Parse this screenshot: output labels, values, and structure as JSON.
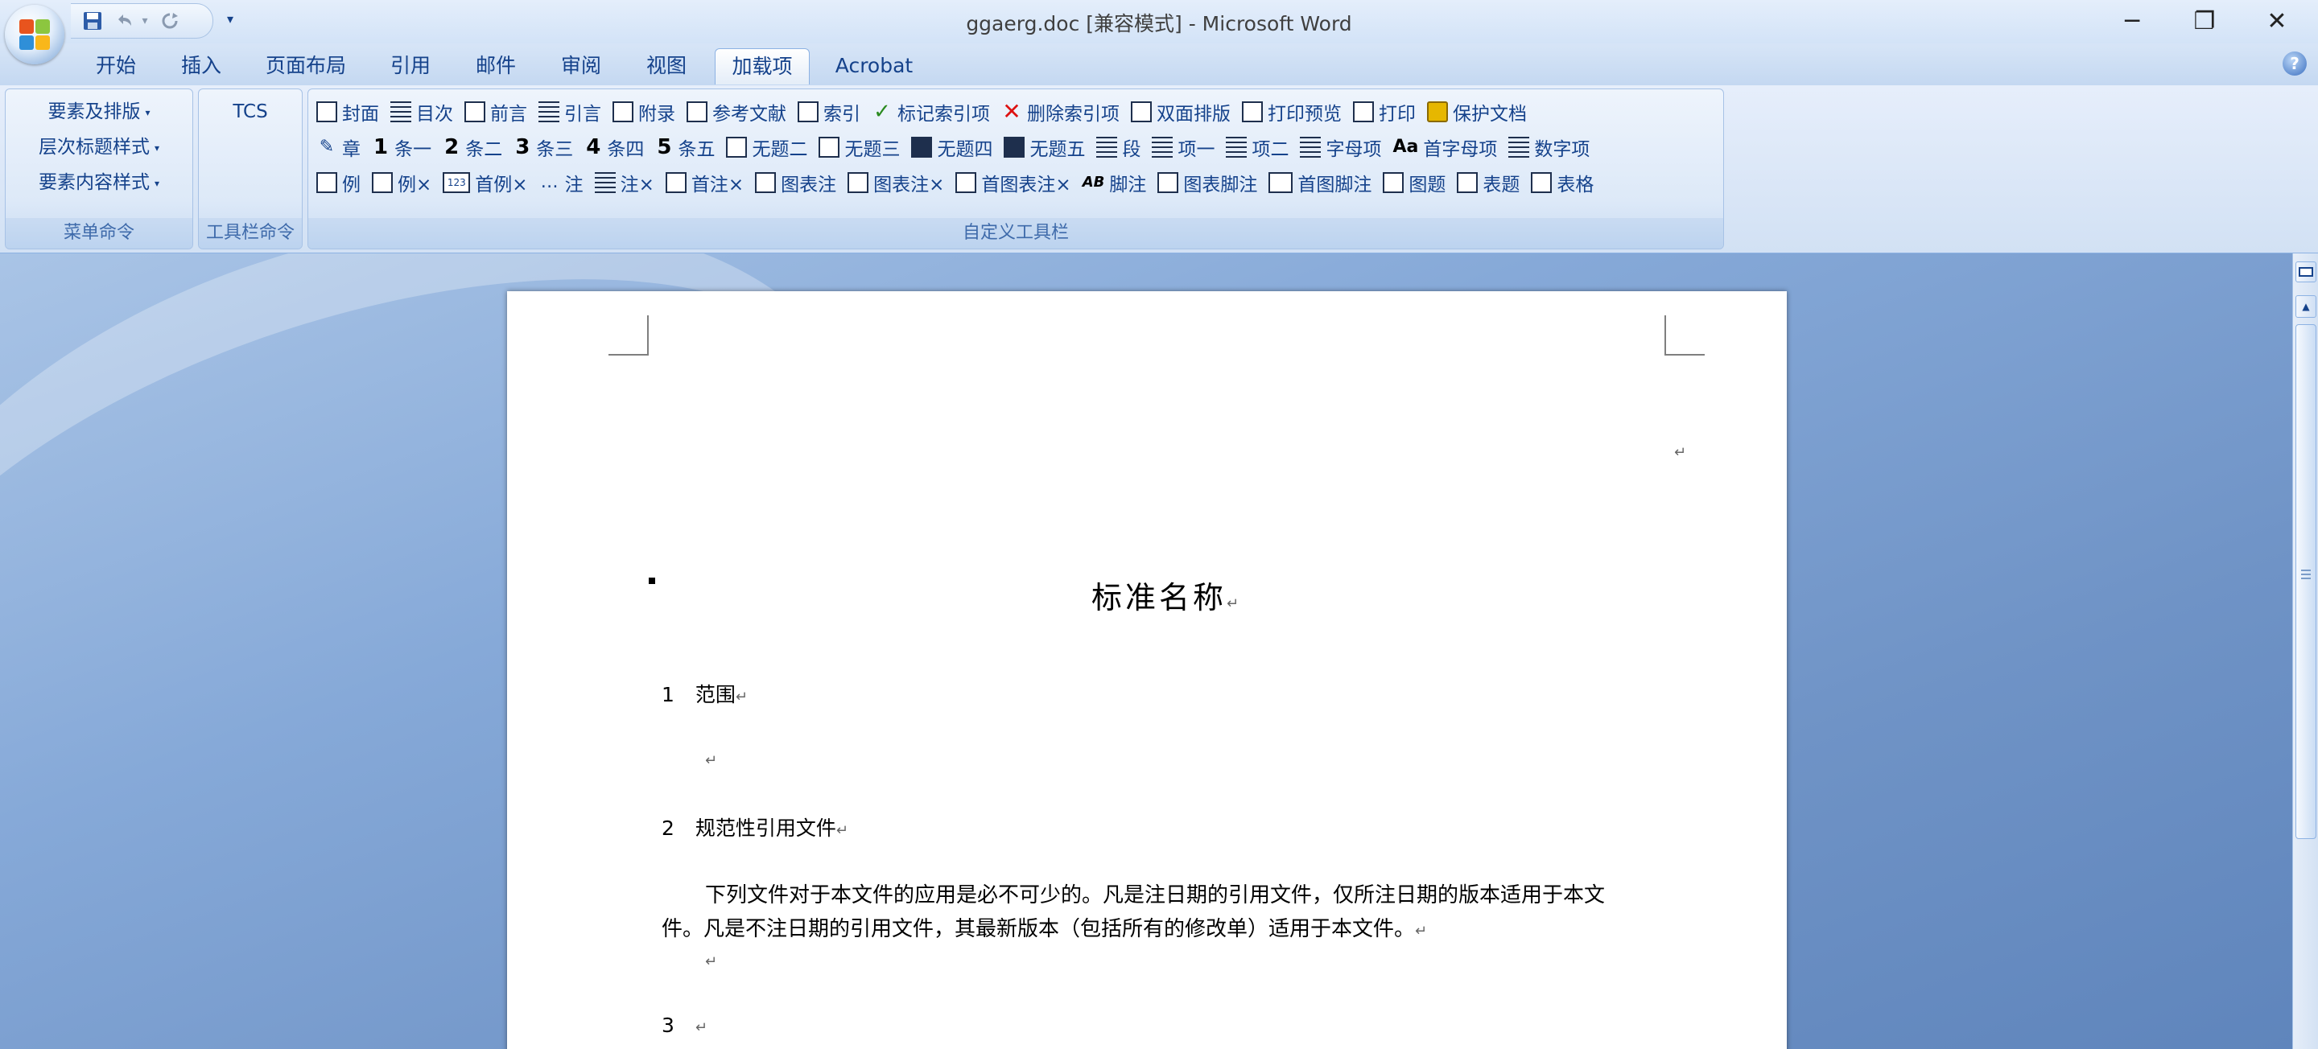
{
  "window": {
    "title": "ggaerg.doc [兼容模式] - Microsoft Word",
    "minimize_icon": "─",
    "restore_icon": "❐",
    "close_icon": "✕"
  },
  "qat": {
    "undo_dropdown": "▾",
    "customize": "▾"
  },
  "tabs": [
    "开始",
    "插入",
    "页面布局",
    "引用",
    "邮件",
    "审阅",
    "视图",
    "加载项",
    "Acrobat"
  ],
  "active_tab": "加载项",
  "help_icon": "?",
  "ribbon": {
    "menu_group": {
      "label": "菜单命令",
      "items": [
        "要素及排版",
        "层次标题样式",
        "要素内容样式"
      ],
      "dropdown_glyph": "▾"
    },
    "toolbar_cmd_group": {
      "label": "工具栏命令",
      "item": "TCS"
    },
    "custom_group": {
      "label": "自定义工具栏",
      "row1": [
        "封面",
        "目次",
        "前言",
        "引言",
        "附录",
        "参考文献",
        "索引",
        "标记索引项",
        "删除索引项",
        "双面排版",
        "打印预览",
        "打印",
        "保护文档"
      ],
      "row2": [
        "章",
        "条一",
        "条二",
        "条三",
        "条四",
        "条五",
        "无题二",
        "无题三",
        "无题四",
        "无题五",
        "段",
        "项一",
        "项二",
        "字母项",
        "首字母项",
        "数字项"
      ],
      "row2_nums": [
        "1",
        "2",
        "3",
        "4",
        "5"
      ],
      "row2_aa": "Aa",
      "row3": [
        "例",
        "例×",
        "首例×",
        "注",
        "注×",
        "首注×",
        "图表注",
        "图表注×",
        "首图表注×",
        "脚注",
        "图表脚注",
        "首图脚注",
        "图题",
        "表题",
        "表格"
      ],
      "row3_ab": "AB",
      "row3_123": "123"
    }
  },
  "document": {
    "title": "标准名称",
    "para_mark": "↵",
    "sections": [
      {
        "num": "1",
        "heading": "范围"
      },
      {
        "num": "2",
        "heading": "规范性引用文件"
      },
      {
        "num": "3",
        "heading": ""
      }
    ],
    "body_line1": "下列文件对于本文件的应用是必不可少的。凡是注日期的引用文件，仅所注日期的版本适用于本文",
    "body_line2": "件。凡是不注日期的引用文件，其最新版本（包括所有的修改单）适用于本文件。"
  }
}
